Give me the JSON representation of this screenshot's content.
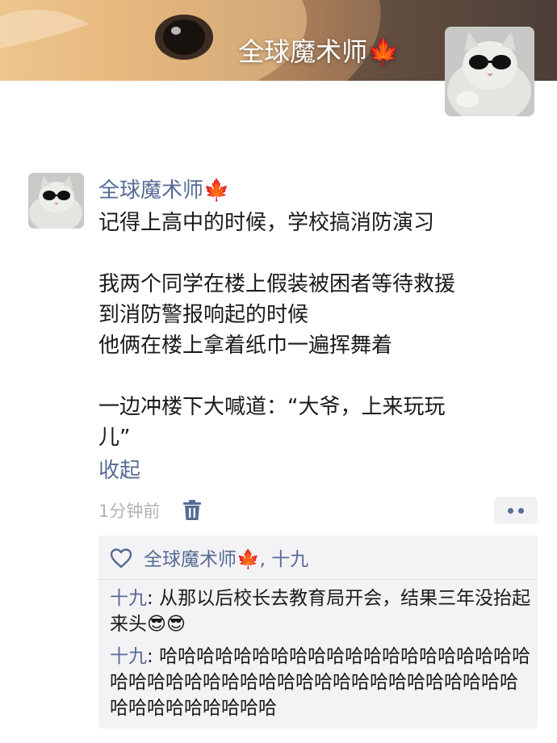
{
  "cover": {
    "name": "全球魔术师🍁"
  },
  "post": {
    "author": "全球魔术师🍁",
    "lines": [
      "记得上高中的时候，学校搞消防演习",
      "",
      "我两个同学在楼上假装被困者等待救援",
      "到消防警报响起的时候",
      "他俩在楼上拿着纸巾一遍挥舞着",
      "",
      "一边冲楼下大喊道：“大爷，上来玩玩",
      "儿”"
    ],
    "collapse_label": "收起",
    "time": "1分钟前"
  },
  "interactions": {
    "likes": "全球魔术师🍁, 十九",
    "comments": [
      {
        "name": "十九",
        "text": "从那以后校长去教育局开会，结果三年没抬起来头😎😎"
      },
      {
        "name": "十九",
        "text": "哈哈哈哈哈哈哈哈哈哈哈哈哈哈哈哈哈哈哈哈哈哈哈哈哈哈哈哈哈哈哈哈哈哈哈哈哈哈哈哈哈哈哈哈哈哈哈哈哈哈哈"
      }
    ]
  },
  "colors": {
    "link": "#576b95",
    "text": "#1a1a1a",
    "meta": "#b2b2b2",
    "panel": "#f3f3f5"
  },
  "icons": [
    "maple-leaf-emoji",
    "trash-icon",
    "more-dots-icon",
    "heart-outline-icon",
    "sunglasses-emoji"
  ]
}
